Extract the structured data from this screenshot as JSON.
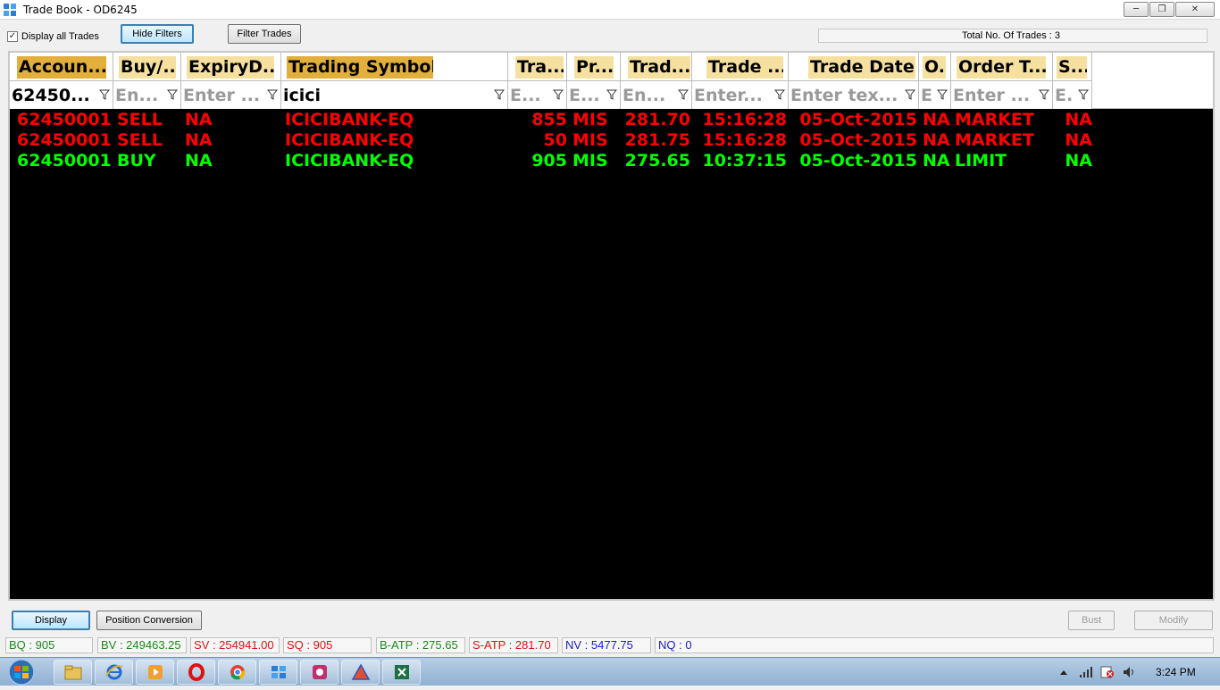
{
  "window": {
    "title": "Trade Book - OD6245",
    "minimize_glyph": "─",
    "maximize_glyph": "❐",
    "close_glyph": "✕"
  },
  "toolbar": {
    "display_all_label": "Display all Trades",
    "display_all_checked": true,
    "hide_filters_label": "Hide Filters",
    "filter_trades_label": "Filter Trades",
    "total_trades": "Total No. Of Trades : 3"
  },
  "grid": {
    "headers": [
      "Accoun...",
      "Buy/...",
      "ExpiryD...",
      "Trading Symbol",
      "Tra...",
      "Pr...",
      "Trad...",
      "Trade ...",
      "Trade Date",
      "O..",
      "Order T...",
      "S..."
    ],
    "filters": [
      {
        "value": "62450...",
        "placeholder": ""
      },
      {
        "value": "",
        "placeholder": "En..."
      },
      {
        "value": "",
        "placeholder": "Enter ..."
      },
      {
        "value": "icici",
        "placeholder": ""
      },
      {
        "value": "",
        "placeholder": "E..."
      },
      {
        "value": "",
        "placeholder": "E..."
      },
      {
        "value": "",
        "placeholder": "En..."
      },
      {
        "value": "",
        "placeholder": "Enter..."
      },
      {
        "value": "",
        "placeholder": "Enter tex..."
      },
      {
        "value": "",
        "placeholder": "E"
      },
      {
        "value": "",
        "placeholder": "Enter ..."
      },
      {
        "value": "",
        "placeholder": "E."
      }
    ],
    "rows": [
      {
        "side": "sell",
        "account": "62450001",
        "buysell": "SELL",
        "expiry": "NA",
        "symbol": "ICICIBANK-EQ",
        "qty": "855",
        "product": "MIS",
        "price": "281.70",
        "time": "15:16:28",
        "date": "05-Oct-2015",
        "o": "NA",
        "order_type": "MARKET",
        "s": "NA"
      },
      {
        "side": "sell",
        "account": "62450001",
        "buysell": "SELL",
        "expiry": "NA",
        "symbol": "ICICIBANK-EQ",
        "qty": "50",
        "product": "MIS",
        "price": "281.75",
        "time": "15:16:28",
        "date": "05-Oct-2015",
        "o": "NA",
        "order_type": "MARKET",
        "s": "NA"
      },
      {
        "side": "buy",
        "account": "62450001",
        "buysell": "BUY",
        "expiry": "NA",
        "symbol": "ICICIBANK-EQ",
        "qty": "905",
        "product": "MIS",
        "price": "275.65",
        "time": "10:37:15",
        "date": "05-Oct-2015",
        "o": "NA",
        "order_type": "LIMIT",
        "s": "NA"
      }
    ]
  },
  "bottom": {
    "display_label": "Display",
    "position_conversion_label": "Position Conversion",
    "bust_label": "Bust",
    "modify_label": "Modify"
  },
  "status": {
    "bq": "BQ : 905",
    "bv": "BV : 249463.25",
    "sv": "SV : 254941.00",
    "sq": "SQ : 905",
    "batp": "B-ATP : 275.65",
    "satp": "S-ATP : 281.70",
    "nv": "NV : 5477.75",
    "nq": "NQ : 0"
  },
  "colors": {
    "sell": "#ff0000",
    "buy": "#00ff00",
    "grid_bg": "#000000",
    "header_sorted": "#e2ae3c",
    "header": "#f5e0a0"
  },
  "taskbar": {
    "clock": "3:24 PM",
    "items": [
      "explorer-icon",
      "ie-icon",
      "media-player-icon",
      "opera-icon",
      "chrome-icon",
      "tradebook-app-icon",
      "paint-app-icon",
      "triangle-app-icon",
      "excel-icon"
    ]
  }
}
